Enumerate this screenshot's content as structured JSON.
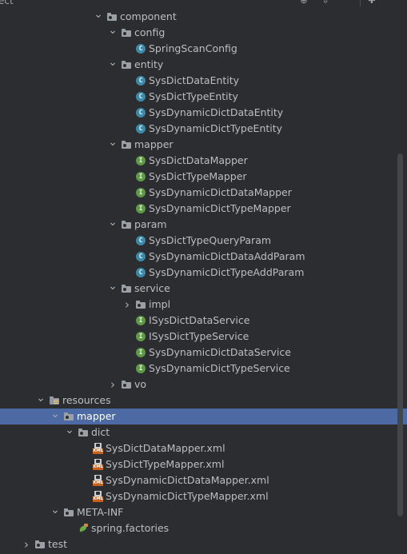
{
  "header": {
    "project_label": "ect"
  },
  "tree": [
    {
      "label": "component",
      "kind": "folder",
      "indent": 0,
      "chevron": "down"
    },
    {
      "label": "config",
      "kind": "folder",
      "indent": 1,
      "chevron": "down"
    },
    {
      "label": "SpringScanConfig",
      "kind": "class",
      "indent": 2,
      "chevron": "none"
    },
    {
      "label": "entity",
      "kind": "folder",
      "indent": 1,
      "chevron": "down"
    },
    {
      "label": "SysDictDataEntity",
      "kind": "class",
      "indent": 2,
      "chevron": "none"
    },
    {
      "label": "SysDictTypeEntity",
      "kind": "class",
      "indent": 2,
      "chevron": "none"
    },
    {
      "label": "SysDynamicDictDataEntity",
      "kind": "class",
      "indent": 2,
      "chevron": "none"
    },
    {
      "label": "SysDynamicDictTypeEntity",
      "kind": "class",
      "indent": 2,
      "chevron": "none"
    },
    {
      "label": "mapper",
      "kind": "folder",
      "indent": 1,
      "chevron": "down"
    },
    {
      "label": "SysDictDataMapper",
      "kind": "interface",
      "indent": 2,
      "chevron": "none"
    },
    {
      "label": "SysDictTypeMapper",
      "kind": "interface",
      "indent": 2,
      "chevron": "none"
    },
    {
      "label": "SysDynamicDictDataMapper",
      "kind": "interface",
      "indent": 2,
      "chevron": "none"
    },
    {
      "label": "SysDynamicDictTypeMapper",
      "kind": "interface",
      "indent": 2,
      "chevron": "none"
    },
    {
      "label": "param",
      "kind": "folder",
      "indent": 1,
      "chevron": "down"
    },
    {
      "label": "SysDictTypeQueryParam",
      "kind": "class",
      "indent": 2,
      "chevron": "none"
    },
    {
      "label": "SysDynamicDictDataAddParam",
      "kind": "class",
      "indent": 2,
      "chevron": "none"
    },
    {
      "label": "SysDynamicDictTypeAddParam",
      "kind": "class",
      "indent": 2,
      "chevron": "none"
    },
    {
      "label": "service",
      "kind": "folder",
      "indent": 1,
      "chevron": "down"
    },
    {
      "label": "impl",
      "kind": "folder",
      "indent": 2,
      "chevron": "right"
    },
    {
      "label": "ISysDictDataService",
      "kind": "interface",
      "indent": 2,
      "chevron": "none"
    },
    {
      "label": "ISysDictTypeService",
      "kind": "interface",
      "indent": 2,
      "chevron": "none"
    },
    {
      "label": "SysDynamicDictDataService",
      "kind": "interface",
      "indent": 2,
      "chevron": "none"
    },
    {
      "label": "SysDynamicDictTypeService",
      "kind": "interface",
      "indent": 2,
      "chevron": "none"
    },
    {
      "label": "vo",
      "kind": "folder",
      "indent": 1,
      "chevron": "right"
    },
    {
      "label": "resources",
      "kind": "resources",
      "indent": -4,
      "chevron": "down"
    },
    {
      "label": "mapper",
      "kind": "folder",
      "indent": -3,
      "chevron": "down",
      "selected": true
    },
    {
      "label": "dict",
      "kind": "folder",
      "indent": -2,
      "chevron": "down"
    },
    {
      "label": "SysDictDataMapper.xml",
      "kind": "xml",
      "indent": -1,
      "chevron": "none"
    },
    {
      "label": "SysDictTypeMapper.xml",
      "kind": "xml",
      "indent": -1,
      "chevron": "none"
    },
    {
      "label": "SysDynamicDictDataMapper.xml",
      "kind": "xml",
      "indent": -1,
      "chevron": "none"
    },
    {
      "label": "SysDynamicDictTypeMapper.xml",
      "kind": "xml",
      "indent": -1,
      "chevron": "none"
    },
    {
      "label": "META-INF",
      "kind": "folder",
      "indent": -3,
      "chevron": "down"
    },
    {
      "label": "spring.factories",
      "kind": "spring",
      "indent": -2,
      "chevron": "none"
    },
    {
      "label": "test",
      "kind": "folder",
      "indent": -5,
      "chevron": "right"
    }
  ]
}
